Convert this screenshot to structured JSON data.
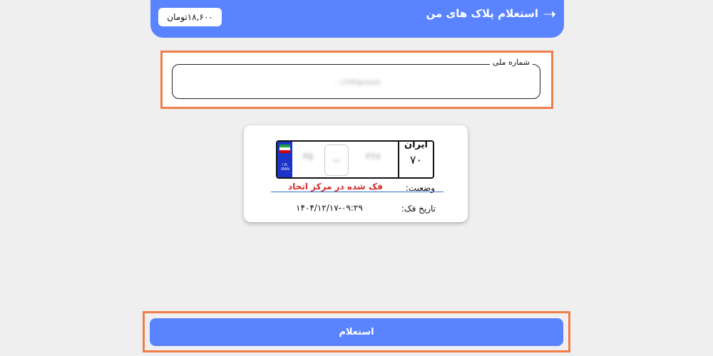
{
  "header": {
    "title": "استعلام پلاک های من",
    "back_icon": "arrow-right-icon",
    "price": "۱۸,۶۰۰تومان"
  },
  "form": {
    "national_id_label": "شماره ملی",
    "national_id_value": "۰۱۲۳۴۵۶۷۸۹"
  },
  "plate": {
    "country_code": "I.R.\nIRAN",
    "number_left": "۴۵",
    "letter": "ب",
    "number_right": "۳۶۷",
    "region_label": "ایران",
    "region_code": "۷۰"
  },
  "result": {
    "status_label": "وضعیت:",
    "status_value": "فک شده در مرکز اتحاد",
    "release_date_label": "تاریخ فک:",
    "release_date_value": "۱۴۰۴/۱۲/۱۷-۰۹:۲۹"
  },
  "actions": {
    "inquiry_label": "استعلام"
  },
  "colors": {
    "primary": "#5a83ff",
    "highlight": "#f07e4b",
    "status": "#d42a2a"
  }
}
